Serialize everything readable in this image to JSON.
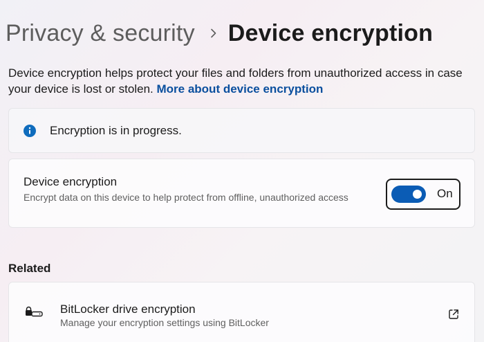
{
  "header": {
    "parent": "Privacy & security",
    "separator_icon": "chevron-right-icon",
    "current": "Device encryption"
  },
  "description": {
    "text": "Device encryption helps protect your files and folders from unauthorized access in case your device is lost or stolen.",
    "link": "More about device encryption"
  },
  "info_banner": {
    "icon": "info-icon",
    "text": "Encryption is in progress."
  },
  "encryption_setting": {
    "title": "Device encryption",
    "description": "Encrypt data on this device to help protect from offline, unauthorized access",
    "toggle_state": "On",
    "toggle_on": true
  },
  "related": {
    "heading": "Related",
    "items": [
      {
        "icon": "bitlocker-key-icon",
        "title": "BitLocker drive encryption",
        "description": "Manage your encryption settings using BitLocker",
        "action_icon": "external-link-icon"
      }
    ]
  },
  "colors": {
    "accent": "#0b5cb5",
    "link": "#0a4f9e",
    "info_icon": "#0f6cbd"
  }
}
